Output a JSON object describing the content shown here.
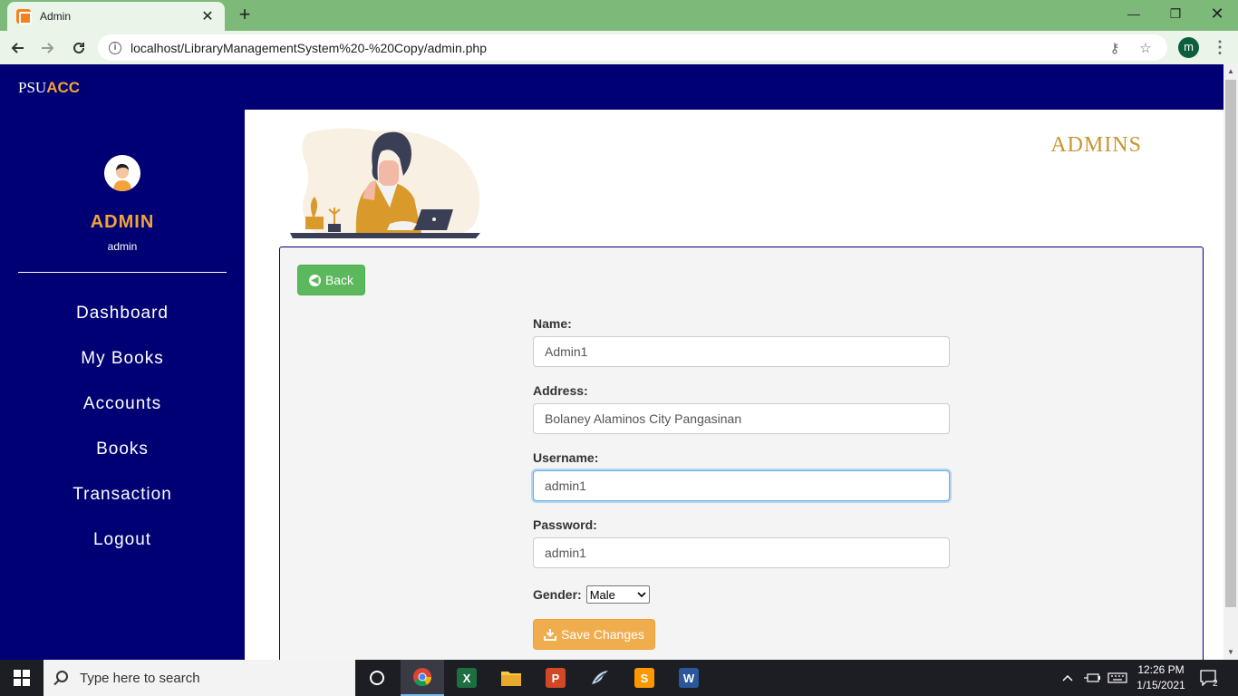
{
  "browser": {
    "tab_title": "Admin",
    "url": "localhost/LibraryManagementSystem%20-%20Copy/admin.php",
    "profile_initial": "m"
  },
  "site": {
    "brand_prefix": "PSU",
    "brand_suffix": "ACC"
  },
  "sidebar": {
    "title": "ADMIN",
    "subtitle": "admin",
    "items": [
      {
        "label": "Dashboard"
      },
      {
        "label": "My Books"
      },
      {
        "label": "Accounts"
      },
      {
        "label": "Books"
      },
      {
        "label": "Transaction"
      },
      {
        "label": "Logout"
      }
    ]
  },
  "main": {
    "heading": "ADMINS",
    "back_label": "Back",
    "form": {
      "name_label": "Name:",
      "name_value": "Admin1",
      "address_label": "Address:",
      "address_value": "Bolaney Alaminos City Pangasinan",
      "username_label": "Username:",
      "username_value": "admin1",
      "password_label": "Password:",
      "password_value": "admin1",
      "gender_label": "Gender:",
      "gender_value": "Male",
      "save_label": "Save Changes"
    }
  },
  "taskbar": {
    "search_placeholder": "Type here to search",
    "time": "12:26 PM",
    "date": "1/15/2021",
    "notification_count": "2"
  },
  "colors": {
    "nav_bg": "#000074",
    "accent": "#f2a33a",
    "heading": "#c9952f",
    "back_button": "#5cb85c",
    "save_button": "#f0ad4e"
  }
}
